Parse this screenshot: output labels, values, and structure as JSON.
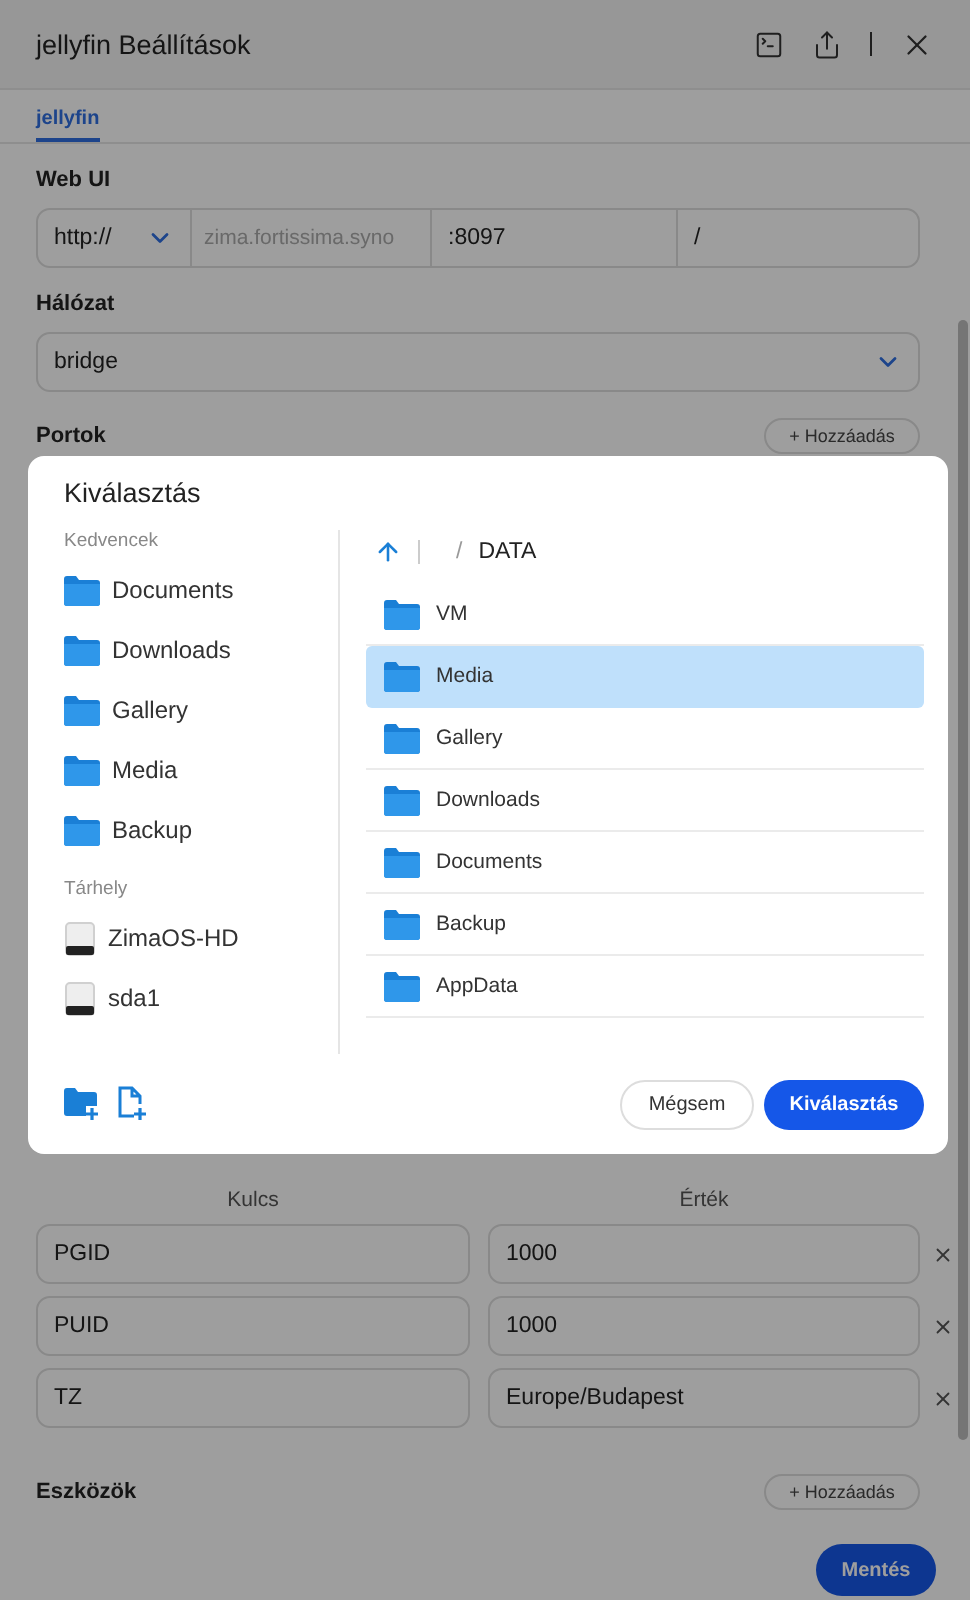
{
  "window": {
    "title": "jellyfin Beállítások"
  },
  "tabs": [
    {
      "label": "jellyfin",
      "selected": true
    }
  ],
  "form": {
    "web_ui": {
      "label": "Web UI",
      "scheme": "http://",
      "host_placeholder": "zima.fortissima.syno",
      "port": ":8097",
      "path": "/"
    },
    "network": {
      "label": "Hálózat",
      "value": "bridge"
    },
    "ports": {
      "label": "Portok",
      "add": "+ Hozzáadás"
    },
    "env": {
      "columns": [
        "Kulcs",
        "Érték"
      ],
      "rows": [
        {
          "key": "PGID",
          "value": "1000"
        },
        {
          "key": "PUID",
          "value": "1000"
        },
        {
          "key": "TZ",
          "value": "Europe/Budapest"
        }
      ]
    },
    "devices": {
      "label": "Eszközök",
      "add": "+ Hozzáadás"
    },
    "save": "Mentés"
  },
  "dialog": {
    "title": "Kiválasztás",
    "sections": [
      {
        "label": "Kedvencek",
        "items": [
          {
            "label": "Documents",
            "kind": "folder"
          },
          {
            "label": "Downloads",
            "kind": "folder"
          },
          {
            "label": "Gallery",
            "kind": "folder"
          },
          {
            "label": "Media",
            "kind": "folder"
          },
          {
            "label": "Backup",
            "kind": "folder"
          }
        ]
      },
      {
        "label": "Tárhely",
        "items": [
          {
            "label": "ZimaOS-HD",
            "kind": "drive"
          },
          {
            "label": "sda1",
            "kind": "drive"
          }
        ]
      }
    ],
    "breadcrumb": {
      "separator": "/",
      "current": "DATA"
    },
    "files": [
      {
        "name": "VM",
        "selected": false
      },
      {
        "name": "Media",
        "selected": true
      },
      {
        "name": "Gallery",
        "selected": false
      },
      {
        "name": "Downloads",
        "selected": false
      },
      {
        "name": "Documents",
        "selected": false
      },
      {
        "name": "Backup",
        "selected": false
      },
      {
        "name": "AppData",
        "selected": false
      }
    ],
    "cancel": "Mégsem",
    "confirm": "Kiválasztás"
  }
}
